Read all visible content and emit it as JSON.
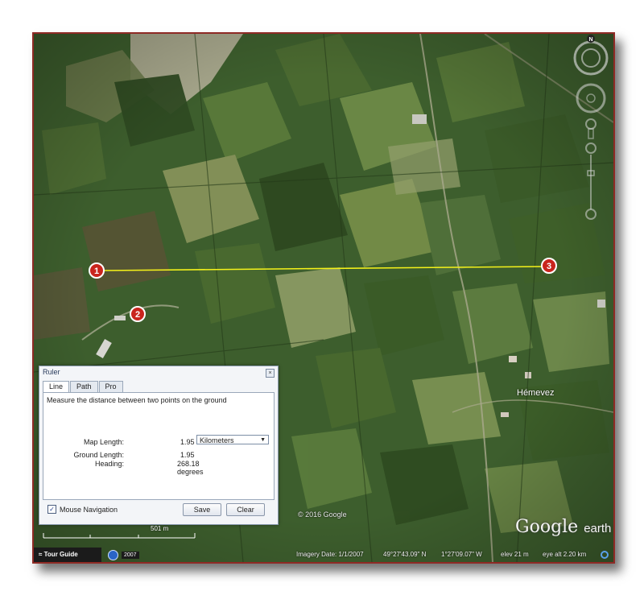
{
  "ruler_dialog": {
    "title": "Ruler",
    "tabs": [
      "Line",
      "Path",
      "Pro"
    ],
    "description": "Measure the distance between two points on the ground",
    "map_length_label": "Map Length:",
    "map_length_value": "1.95",
    "unit_selected": "Kilometers",
    "ground_length_label": "Ground Length:",
    "ground_length_value": "1.95",
    "heading_label": "Heading:",
    "heading_value": "268.18 degrees",
    "mouse_navigation_label": "Mouse Navigation",
    "mouse_navigation_checked": true,
    "save_label": "Save",
    "clear_label": "Clear"
  },
  "markers": [
    "1",
    "2",
    "3"
  ],
  "place_label": "Hémevez",
  "scale_label": "501 m",
  "copyright": "© 2016 Google",
  "logo": {
    "main": "Google",
    "sub": "earth"
  },
  "compass_label": "N",
  "status_bar": {
    "tour_guide": "Tour Guide",
    "history_year": "2007",
    "imagery_date": "Imagery Date: 1/1/2007",
    "latitude": "49°27'43.09\" N",
    "longitude": "1°27'09.07\" W",
    "elevation": "elev  21 m",
    "eye_alt": "eye alt  2.20 km"
  },
  "colors": {
    "frame_border": "#8e2a25",
    "measure_line": "#f5f21a",
    "marker_fill": "#c9241d"
  }
}
